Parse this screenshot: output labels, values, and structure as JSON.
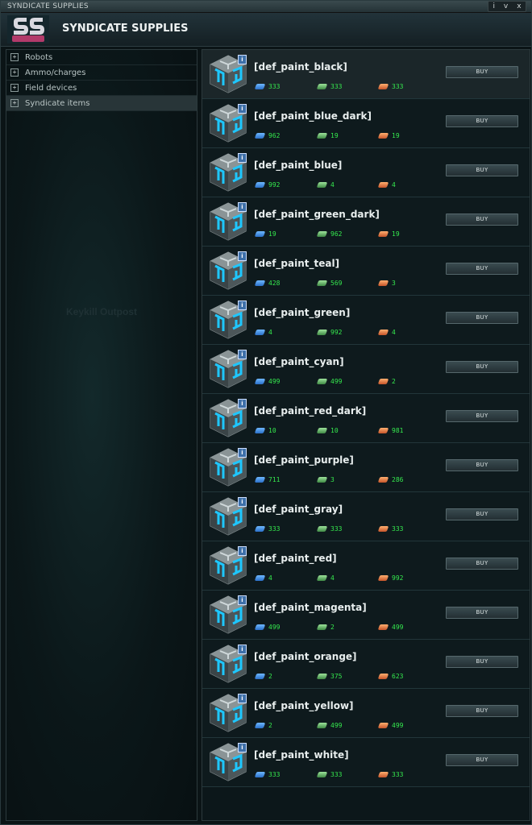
{
  "window": {
    "title": "SYNDICATE SUPPLIES",
    "controls": [
      "i",
      "v",
      "x"
    ]
  },
  "header": {
    "title": "SYNDICATE SUPPLIES"
  },
  "sidebar": {
    "categories": [
      {
        "label": "Robots",
        "expander": "+"
      },
      {
        "label": "Ammo/charges",
        "expander": "+"
      },
      {
        "label": "Field devices",
        "expander": "+"
      },
      {
        "label": "Syndicate items",
        "expander": "+"
      }
    ],
    "selected_index": 3,
    "background_label": "Keykill Outpost"
  },
  "items": [
    {
      "name": "[def_paint_black]",
      "prices": [
        "333",
        "333",
        "333"
      ],
      "buy_label": "BUY"
    },
    {
      "name": "[def_paint_blue_dark]",
      "prices": [
        "962",
        "19",
        "19"
      ],
      "buy_label": "BUY"
    },
    {
      "name": "[def_paint_blue]",
      "prices": [
        "992",
        "4",
        "4"
      ],
      "buy_label": "BUY"
    },
    {
      "name": "[def_paint_green_dark]",
      "prices": [
        "19",
        "962",
        "19"
      ],
      "buy_label": "BUY"
    },
    {
      "name": "[def_paint_teal]",
      "prices": [
        "428",
        "569",
        "3"
      ],
      "buy_label": "BUY"
    },
    {
      "name": "[def_paint_green]",
      "prices": [
        "4",
        "992",
        "4"
      ],
      "buy_label": "BUY"
    },
    {
      "name": "[def_paint_cyan]",
      "prices": [
        "499",
        "499",
        "2"
      ],
      "buy_label": "BUY"
    },
    {
      "name": "[def_paint_red_dark]",
      "prices": [
        "10",
        "10",
        "981"
      ],
      "buy_label": "BUY"
    },
    {
      "name": "[def_paint_purple]",
      "prices": [
        "711",
        "3",
        "286"
      ],
      "buy_label": "BUY"
    },
    {
      "name": "[def_paint_gray]",
      "prices": [
        "333",
        "333",
        "333"
      ],
      "buy_label": "BUY"
    },
    {
      "name": "[def_paint_red]",
      "prices": [
        "4",
        "4",
        "992"
      ],
      "buy_label": "BUY"
    },
    {
      "name": "[def_paint_magenta]",
      "prices": [
        "499",
        "2",
        "499"
      ],
      "buy_label": "BUY"
    },
    {
      "name": "[def_paint_orange]",
      "prices": [
        "2",
        "375",
        "623"
      ],
      "buy_label": "BUY"
    },
    {
      "name": "[def_paint_yellow]",
      "prices": [
        "2",
        "499",
        "499"
      ],
      "buy_label": "BUY"
    },
    {
      "name": "[def_paint_white]",
      "prices": [
        "333",
        "333",
        "333"
      ],
      "buy_label": "BUY"
    }
  ],
  "currency_icons": [
    "blue-currency-icon",
    "green-currency-icon",
    "orange-currency-icon"
  ],
  "info_badge": "i",
  "colors": {
    "price_text": "#35e84e",
    "accent": "#3aa6e0"
  }
}
